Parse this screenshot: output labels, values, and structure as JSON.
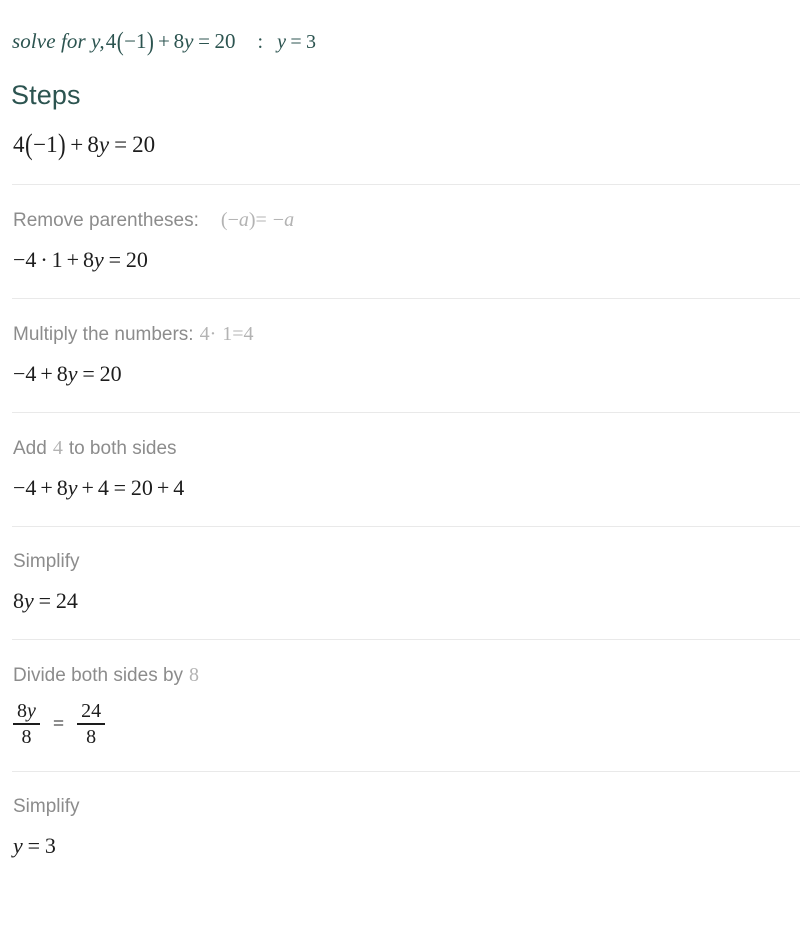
{
  "colors": {
    "accent": "#2c5450",
    "body_text": "#1d1d1d",
    "label_gray": "#8c8c8c",
    "math_gray": "#b3b3b3",
    "divider": "#e9e9e9",
    "background": "#ffffff"
  },
  "query": {
    "prompt": "solve for y,",
    "expression": {
      "coef": "4",
      "lparen": "(",
      "minus": "−",
      "one": "1",
      "rparen": ")",
      "plus": "+",
      "term": "8",
      "var": "y",
      "equals": "=",
      "rhs": "20"
    },
    "separator": ":",
    "answer": {
      "var": "y",
      "equals": "=",
      "value": "3"
    }
  },
  "steps_heading": "Steps",
  "steps": [
    {
      "id": "initial",
      "has_divider": false,
      "label": null,
      "label_math": null,
      "expression_parts": [
        "4",
        "(",
        "−",
        "1",
        ")",
        "+",
        "8",
        "y",
        "=",
        "20"
      ],
      "expression_text": "4(−1) + 8y = 20"
    },
    {
      "id": "remove-parentheses",
      "has_divider": true,
      "label": "Remove parentheses:",
      "label_math": "(−a) = −a",
      "label_math_parts": [
        "(",
        "−",
        "a",
        ")",
        "=",
        "−",
        "a"
      ],
      "expression_parts": [
        "−",
        "4",
        "·",
        "1",
        "+",
        "8",
        "y",
        "=",
        "20"
      ],
      "expression_text": "−4 · 1 + 8y = 20"
    },
    {
      "id": "multiply-the-numbers",
      "has_divider": true,
      "label": "Multiply the numbers:",
      "label_math": "4 · 1 = 4",
      "label_math_parts": [
        "4",
        "·",
        "1",
        "=",
        "4"
      ],
      "expression_parts": [
        "−",
        "4",
        "+",
        "8",
        "y",
        "=",
        "20"
      ],
      "expression_text": "−4 + 8y = 20"
    },
    {
      "id": "add-4-to-both-sides",
      "has_divider": true,
      "label_prefix": "Add",
      "label_number": "4",
      "label_suffix": "to both sides",
      "label": "Add 4 to both sides",
      "expression_parts": [
        "−",
        "4",
        "+",
        "8",
        "y",
        "+",
        "4",
        "=",
        "20",
        "+",
        "4"
      ],
      "expression_text": "−4 + 8y + 4 = 20 + 4"
    },
    {
      "id": "simplify-1",
      "has_divider": true,
      "label": "Simplify",
      "label_math": null,
      "expression_parts": [
        "8",
        "y",
        "=",
        "24"
      ],
      "expression_text": "8y = 24"
    },
    {
      "id": "divide-both-sides-by-8",
      "has_divider": true,
      "label_prefix": "Divide both sides by",
      "label_number": "8",
      "label": "Divide both sides by 8",
      "fraction": {
        "left_numerator": "8y",
        "left_denominator": "8",
        "equals": "=",
        "right_numerator": "24",
        "right_denominator": "8"
      },
      "expression_text": "8y/8 = 24/8"
    },
    {
      "id": "simplify-2",
      "has_divider": true,
      "label": "Simplify",
      "label_math": null,
      "expression_parts": [
        "y",
        "=",
        "3"
      ],
      "expression_text": "y = 3"
    }
  ]
}
